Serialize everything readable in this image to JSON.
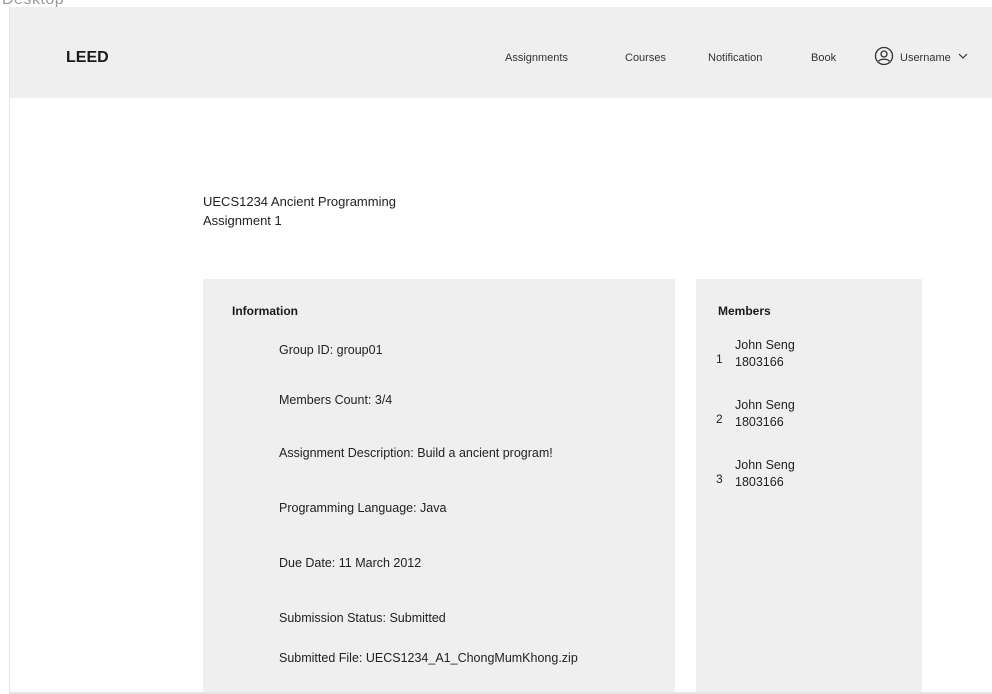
{
  "canvas": {
    "label": "Desktop"
  },
  "navbar": {
    "brand": "LEED",
    "links": [
      {
        "label": "Assignments"
      },
      {
        "label": "Courses"
      },
      {
        "label": "Notification"
      },
      {
        "label": "Book"
      }
    ],
    "user": {
      "label": "Username",
      "icon": "user-circle-icon",
      "caret_icon": "chevron-down-icon"
    }
  },
  "page": {
    "course": "UECS1234 Ancient Programming",
    "assignment": "Assignment 1"
  },
  "information": {
    "title": "Information",
    "lines": [
      "Group ID: group01",
      "Members Count: 3/4",
      "Assignment Description: Build a ancient program!",
      "Programming Language: Java",
      "Due Date: 11 March 2012",
      "Submission Status: Submitted",
      "Submitted File: UECS1234_A1_ChongMumKhong.zip"
    ]
  },
  "members": {
    "title": "Members",
    "items": [
      {
        "index": "1",
        "name": "John Seng",
        "id": "1803166"
      },
      {
        "index": "2",
        "name": "John Seng",
        "id": "1803166"
      },
      {
        "index": "3",
        "name": "John Seng",
        "id": "1803166"
      }
    ]
  },
  "colors": {
    "navbar_bg": "#efefef",
    "panel_bg": "#efefef",
    "text": "#1a1a1a"
  }
}
